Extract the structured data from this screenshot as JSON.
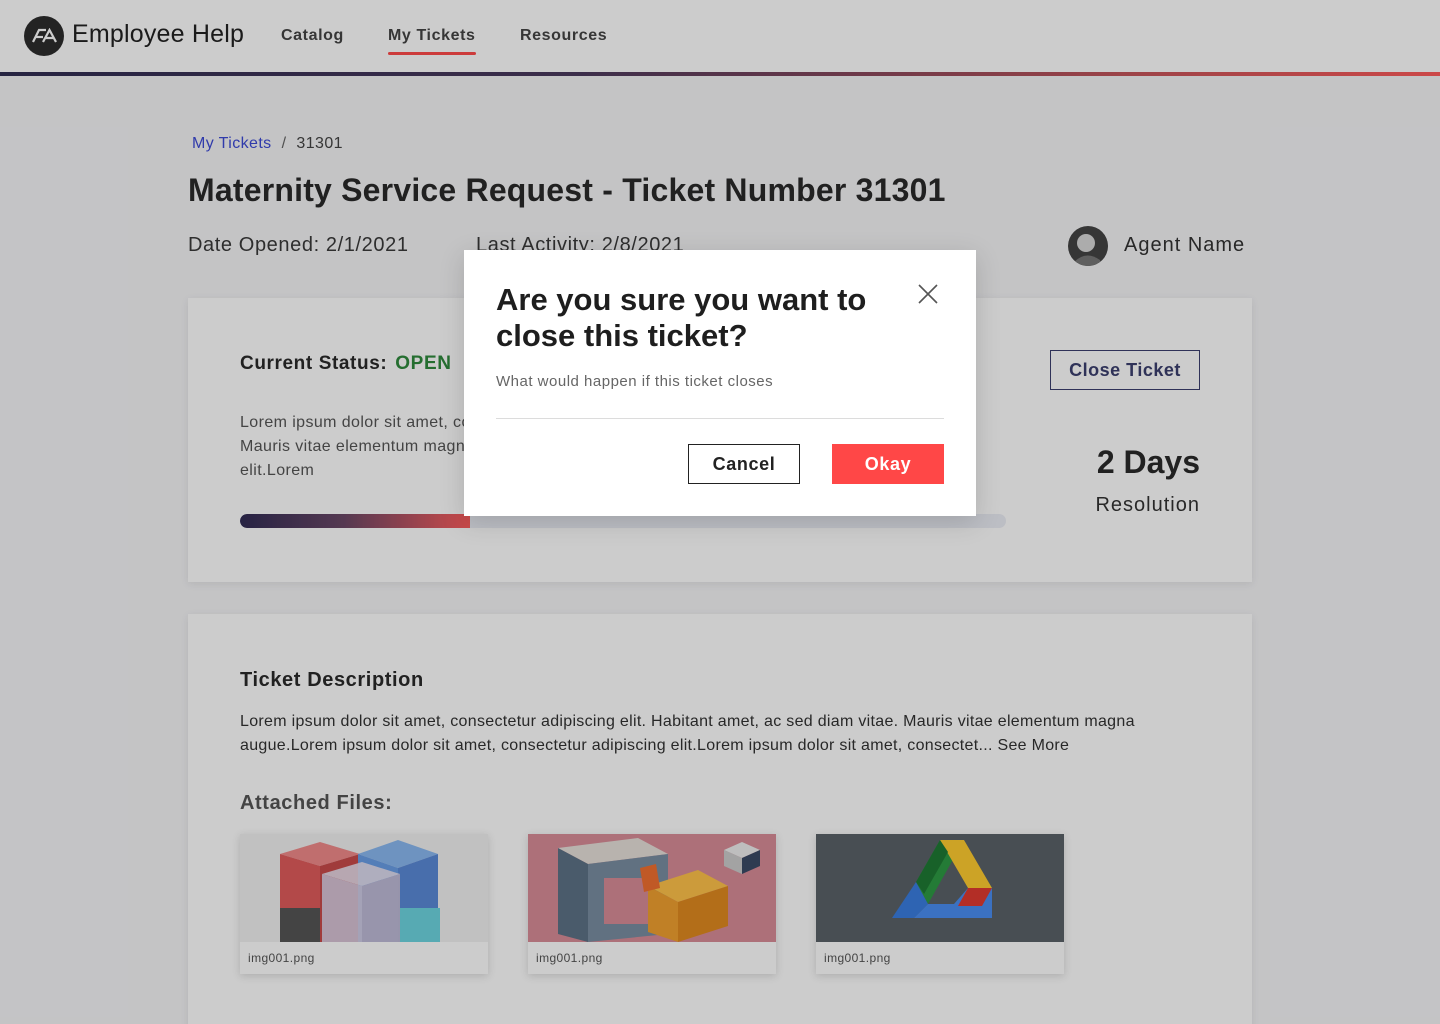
{
  "header": {
    "logo_text": "EA",
    "title": "Employee Help",
    "nav": [
      {
        "label": "Catalog",
        "active": false
      },
      {
        "label": "My Tickets",
        "active": true
      },
      {
        "label": "Resources",
        "active": false
      }
    ]
  },
  "breadcrumb": {
    "parent": "My Tickets",
    "separator": "/",
    "current": "31301"
  },
  "ticket": {
    "title": "Maternity Service Request - Ticket Number 31301",
    "date_opened": "Date Opened: 2/1/2021",
    "last_activity": "Last Activity: 2/8/2021",
    "agent_name": "Agent Name"
  },
  "status": {
    "label": "Current Status:",
    "value": "OPEN",
    "text": "Lorem ipsum dolor sit amet, consectetur adipiscing elit. Habitant amet, ac sed diam vitae. Mauris vitae elementum magna augue.Lorem ipsum dolor sit amet, consectetur adipiscing elit.Lorem",
    "progress_percent": 30,
    "close_button": "Close Ticket",
    "resolution_value": "2 Days",
    "resolution_label": "Resolution"
  },
  "description": {
    "title": "Ticket Description",
    "text": "Lorem ipsum dolor sit amet, consectetur adipiscing elit. Habitant amet, ac sed diam vitae. Mauris vitae elementum magna augue.Lorem ipsum dolor sit amet, consectetur adipiscing elit.Lorem ipsum dolor sit amet, consectet...",
    "see_more": "See More",
    "files_title": "Attached Files:",
    "files": [
      {
        "name": "img001.png"
      },
      {
        "name": "img001.png"
      },
      {
        "name": "img001.png"
      }
    ]
  },
  "modal": {
    "title": "Are you sure you want to close this ticket?",
    "subtitle": "What would happen if this ticket closes",
    "cancel": "Cancel",
    "okay": "Okay"
  },
  "colors": {
    "accent": "#ff4747",
    "link": "#3d4ad6",
    "status_open": "#2f8a3d",
    "close_button_border": "#3b3f6e"
  },
  "icons": {
    "logo": "ea-logo-icon",
    "close": "close-icon",
    "avatar": "agent-avatar"
  }
}
